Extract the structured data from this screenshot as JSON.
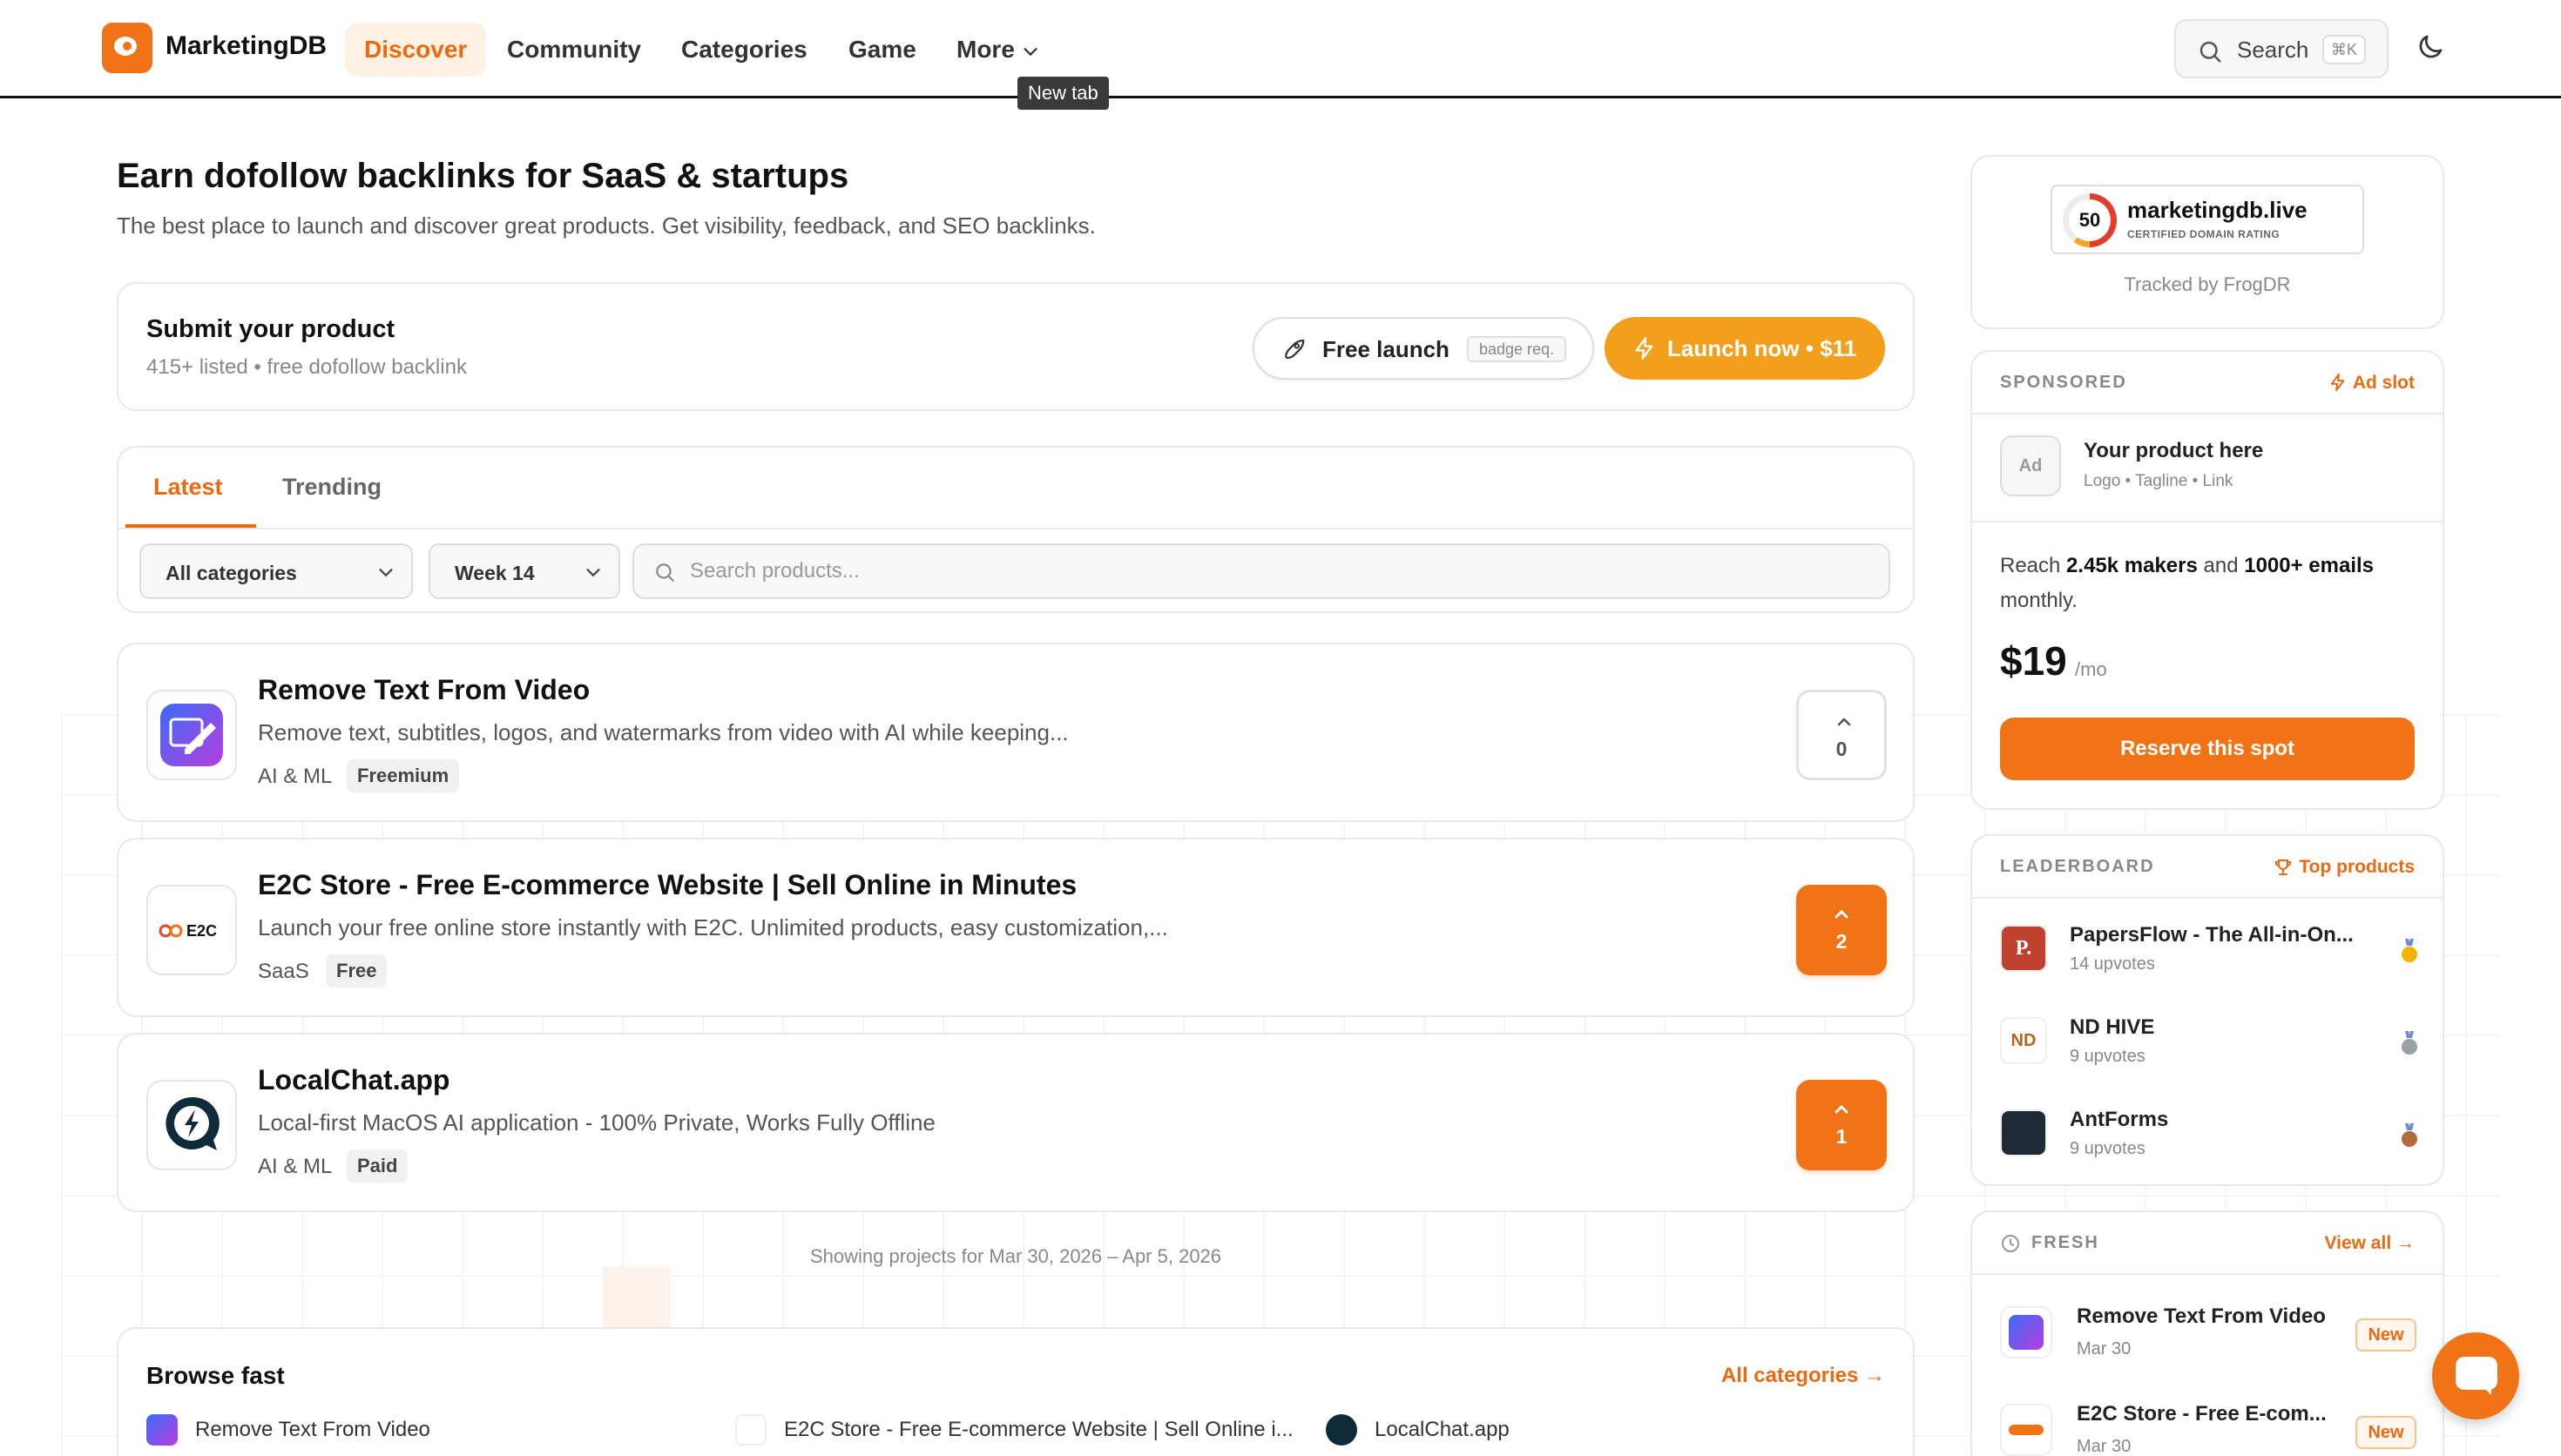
{
  "header": {
    "brand": "MarketingDB",
    "nav": [
      "Discover",
      "Community",
      "Categories",
      "Game",
      "More"
    ],
    "tooltip": "New tab",
    "search_label": "Search",
    "search_shortcut": "⌘K"
  },
  "hero": {
    "title": "Earn dofollow backlinks for SaaS & startups",
    "subtitle": "The best place to launch and discover great products. Get visibility, feedback, and SEO backlinks."
  },
  "submit": {
    "title": "Submit your product",
    "meta": "415+ listed • free dofollow backlink",
    "free_label": "Free launch",
    "free_badge": "badge req.",
    "launch_label": "Launch now • $11"
  },
  "tabs": [
    "Latest",
    "Trending"
  ],
  "filters": {
    "category": "All categories",
    "week": "Week 14",
    "search_placeholder": "Search products..."
  },
  "products": [
    {
      "title": "Remove Text From Video",
      "desc": "Remove text, subtitles, logos, and watermarks from video with AI while keeping...",
      "category": "AI & ML",
      "tag": "Freemium",
      "votes": "0",
      "voted": false
    },
    {
      "title": "E2C Store - Free E-commerce Website | Sell Online in Minutes",
      "desc": "Launch your free online store instantly with E2C. Unlimited products, easy customization,...",
      "category": "SaaS",
      "tag": "Free",
      "votes": "2",
      "voted": true
    },
    {
      "title": "LocalChat.app",
      "desc": "Local-first MacOS AI application - 100% Private, Works Fully Offline",
      "category": "AI & ML",
      "tag": "Paid",
      "votes": "1",
      "voted": true
    }
  ],
  "showing": "Showing projects for Mar 30, 2026 – Apr 5, 2026",
  "browse": {
    "title": "Browse fast",
    "all_link": "All categories →",
    "items": [
      "Remove Text From Video",
      "E2C Store - Free E-commerce Website | Sell Online i...",
      "LocalChat.app"
    ]
  },
  "sidebar": {
    "dr": {
      "score": "50",
      "domain": "marketingdb.live",
      "cert": "CERTIFIED DOMAIN RATING",
      "tracked": "Tracked by FrogDR"
    },
    "sponsored": {
      "label": "SPONSORED",
      "link": "Ad slot",
      "ad_box": "Ad",
      "ad_title": "Your product here",
      "ad_meta": "Logo • Tagline • Link",
      "reach_prefix": "Reach ",
      "reach_makers": "2.45k makers",
      "reach_mid": " and ",
      "reach_emails": "1000+ emails",
      "reach_suffix": " monthly.",
      "price": "$19",
      "price_per": "/mo",
      "cta": "Reserve this spot"
    },
    "leaderboard": {
      "label": "LEADERBOARD",
      "link": "Top products",
      "items": [
        {
          "name": "PapersFlow - The All-in-On...",
          "votes": "14 upvotes",
          "icon_letter": "P."
        },
        {
          "name": "ND HIVE",
          "votes": "9 upvotes",
          "icon_letter": "ND"
        },
        {
          "name": "AntForms",
          "votes": "9 upvotes",
          "icon_letter": ""
        }
      ]
    },
    "fresh": {
      "label": "FRESH",
      "link": "View all →",
      "items": [
        {
          "name": "Remove Text From Video",
          "date": "Mar 30",
          "badge": "New"
        },
        {
          "name": "E2C Store - Free E-com...",
          "date": "Mar 30",
          "badge": "New"
        }
      ]
    }
  },
  "colors": {
    "accent": "#f07316",
    "launch": "#f2a01c",
    "gold": "#f5b400",
    "silver": "#9aa0a6",
    "bronze": "#b46a3c"
  },
  "icons": [
    "search-icon",
    "moon-icon",
    "rocket-icon",
    "bolt-icon",
    "chevron-down-icon",
    "upvote-arrow-icon",
    "trophy-icon",
    "clock-icon",
    "chat-icon"
  ]
}
